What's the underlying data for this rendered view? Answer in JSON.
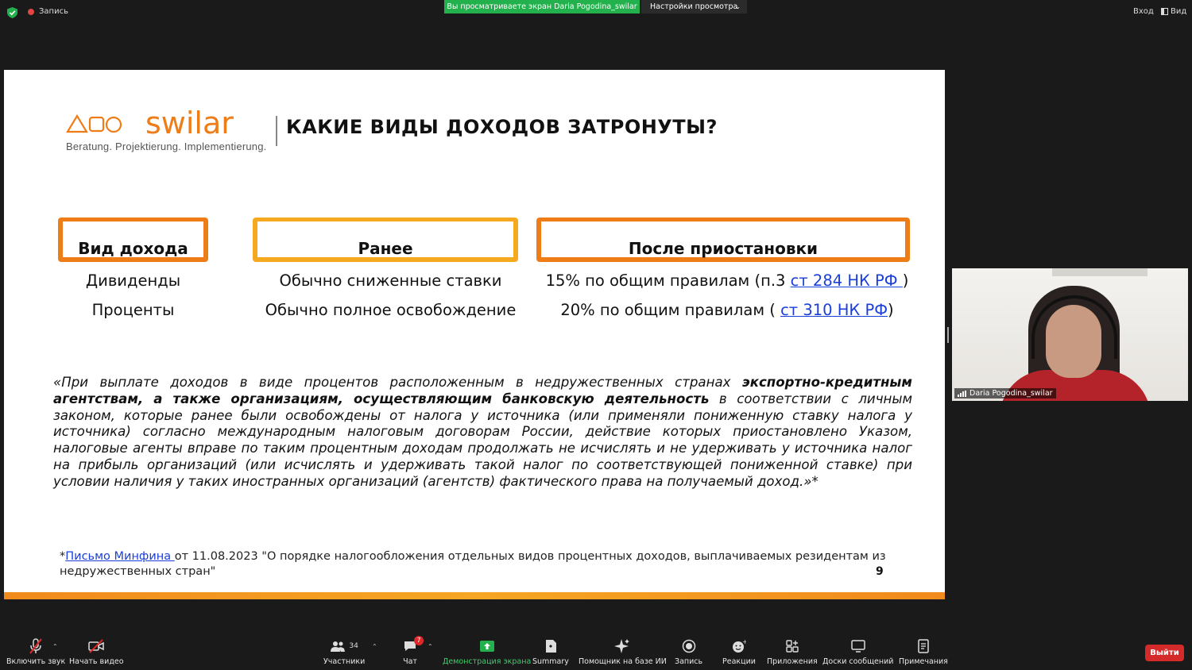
{
  "topbar": {
    "record_label": "Запись",
    "viewing_banner": "Вы просматриваете экран Daria Pogodina_swilar",
    "view_options": "Настройки просмотра",
    "right_items": [
      "Вход",
      "Вид"
    ]
  },
  "slide": {
    "logo_text": "swilar",
    "logo_tagline": "Beratung. Projektierung. Implementierung.",
    "title": "КАКИЕ ВИДЫ ДОХОДОВ ЗАТРОНУТЫ?",
    "table": {
      "headers": [
        "Вид дохода",
        "Ранее",
        "После приостановки"
      ],
      "rows": [
        {
          "type": "Дивиденды",
          "before": "Обычно сниженные ставки",
          "after_prefix": "15% по общим правилам (п.3 ",
          "after_link": "ст 284 НК РФ ",
          "after_suffix": ")"
        },
        {
          "type": "Проценты",
          "before": "Обычно полное освобождение",
          "after_prefix": "20% по общим правилам ( ",
          "after_link": "ст 310 НК РФ",
          "after_suffix": ")"
        }
      ]
    },
    "quote": {
      "part1": "«При выплате доходов в виде процентов расположенным в недружественных странах ",
      "bold": "экспортно-кредитным агентствам, а также организациям, осуществляющим банковскую деятельность",
      "part2": " в соответствии с личным законом, которые ранее были освобождены от налога у источника (или применяли пониженную ставку налога у источника) согласно международным налоговым договорам России, действие которых приостановлено Указом, налоговые агенты вправе по таким процентным доходам продолжать не исчислять и не удерживать у источника налог на прибыль организаций (или исчислять и удерживать такой налог по соответствующей пониженной ставке) при условии наличия у таких иностранных организаций (агентств) фактического права на получаемый доход.»*"
    },
    "footnote": {
      "star": "*",
      "link": "Письмо Минфина ",
      "text": "от 11.08.2023 \"О порядке налогообложения отдельных видов процентных доходов, выплачиваемых резидентам из недружественных стран\""
    },
    "page_number": "9"
  },
  "webcam": {
    "name": "Daria Pogodina_swilar"
  },
  "toolbar": {
    "unmute": "Включить звук",
    "start_video": "Начать видео",
    "participants": "Участники",
    "participants_count": "34",
    "chat": "Чат",
    "chat_badge": "7",
    "share_screen": "Демонстрация экрана",
    "summary": "Summary",
    "ai_companion": "Помощник на базе ИИ",
    "record": "Запись",
    "reactions": "Реакции",
    "apps": "Приложения",
    "whiteboards": "Доски сообщений",
    "notes": "Примечания",
    "leave": "Выйти"
  },
  "colors": {
    "accent_orange": "#ee7d18",
    "accent_yellow": "#f5a91e",
    "share_green": "#23b14d",
    "leave_red": "#d42a2a",
    "link_blue": "#1a3fd8"
  }
}
